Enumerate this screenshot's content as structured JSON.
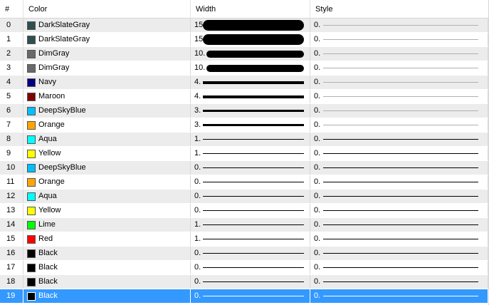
{
  "columns": [
    {
      "label": "#"
    },
    {
      "label": "Color"
    },
    {
      "label": "Width"
    },
    {
      "label": "Style"
    }
  ],
  "rows": [
    {
      "index": "0",
      "color_name": "DarkSlateGray",
      "swatch": "#2f4f4f",
      "width_text": "15",
      "width_value": 15,
      "style_text": "0."
    },
    {
      "index": "1",
      "color_name": "DarkSlateGray",
      "swatch": "#2f4f4f",
      "width_text": "15",
      "width_value": 15,
      "style_text": "0."
    },
    {
      "index": "2",
      "color_name": "DimGray",
      "swatch": "#696969",
      "width_text": "10.",
      "width_value": 10,
      "style_text": "0."
    },
    {
      "index": "3",
      "color_name": "DimGray",
      "swatch": "#696969",
      "width_text": "10.",
      "width_value": 10,
      "style_text": "0."
    },
    {
      "index": "4",
      "color_name": "Navy",
      "swatch": "#000080",
      "width_text": "4.",
      "width_value": 4,
      "style_text": "0."
    },
    {
      "index": "5",
      "color_name": "Maroon",
      "swatch": "#800000",
      "width_text": "4.",
      "width_value": 4,
      "style_text": "0."
    },
    {
      "index": "6",
      "color_name": "DeepSkyBlue",
      "swatch": "#00bfff",
      "width_text": "3.",
      "width_value": 3,
      "style_text": "0."
    },
    {
      "index": "7",
      "color_name": "Orange",
      "swatch": "#ffa500",
      "width_text": "3.",
      "width_value": 3,
      "style_text": "0."
    },
    {
      "index": "8",
      "color_name": "Aqua",
      "swatch": "#00ffff",
      "width_text": "1.",
      "width_value": 1,
      "style_text": "0."
    },
    {
      "index": "9",
      "color_name": "Yellow",
      "swatch": "#ffff00",
      "width_text": "1.",
      "width_value": 1,
      "style_text": "0."
    },
    {
      "index": "10",
      "color_name": "DeepSkyBlue",
      "swatch": "#00bfff",
      "width_text": "0.",
      "width_value": 1,
      "style_text": "0."
    },
    {
      "index": "11",
      "color_name": "Orange",
      "swatch": "#ffa500",
      "width_text": "0.",
      "width_value": 1,
      "style_text": "0."
    },
    {
      "index": "12",
      "color_name": "Aqua",
      "swatch": "#00ffff",
      "width_text": "0.",
      "width_value": 1,
      "style_text": "0."
    },
    {
      "index": "13",
      "color_name": "Yellow",
      "swatch": "#ffff00",
      "width_text": "0.",
      "width_value": 1,
      "style_text": "0."
    },
    {
      "index": "14",
      "color_name": "Lime",
      "swatch": "#00ff00",
      "width_text": "1.",
      "width_value": 1,
      "style_text": "0."
    },
    {
      "index": "15",
      "color_name": "Red",
      "swatch": "#ff0000",
      "width_text": "1.",
      "width_value": 1,
      "style_text": "0."
    },
    {
      "index": "16",
      "color_name": "Black",
      "swatch": "#000000",
      "width_text": "0.",
      "width_value": 1,
      "style_text": "0."
    },
    {
      "index": "17",
      "color_name": "Black",
      "swatch": "#000000",
      "width_text": "0.",
      "width_value": 1,
      "style_text": "0."
    },
    {
      "index": "18",
      "color_name": "Black",
      "swatch": "#000000",
      "width_text": "0.",
      "width_value": 1,
      "style_text": "0."
    },
    {
      "index": "19",
      "color_name": "Black",
      "swatch": "#000000",
      "width_text": "0.",
      "width_value": 1,
      "style_text": "0.",
      "selected": true
    }
  ],
  "colors": {
    "selection": "#3399ff",
    "alt_row": "#ececec",
    "style_line": "#b0b0b0"
  }
}
